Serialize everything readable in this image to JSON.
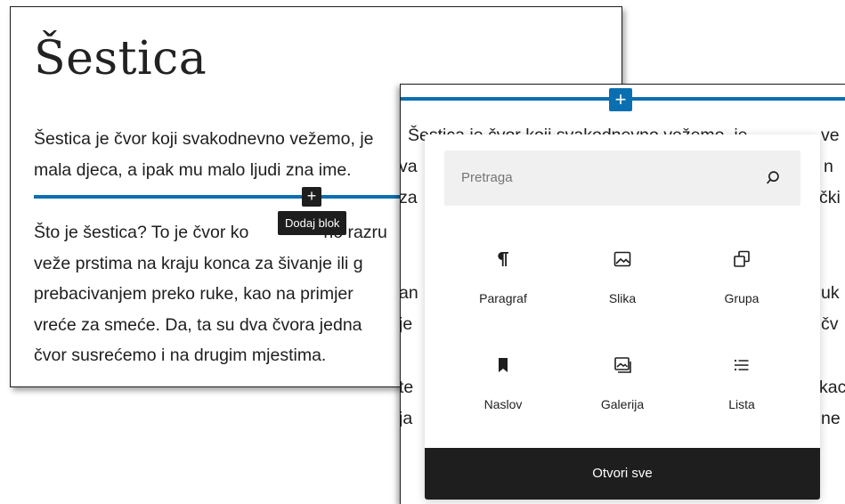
{
  "post": {
    "title": "Šestica",
    "para1_lines": [
      "Šestica je čvor koji svakodnevno vežemo, je",
      "mala djeca, a ipak mu malo ljudi zna ime."
    ],
    "para2_lines": [
      "Što je šestica? To je čvor ko",
      "veže prstima na kraju konca za šivanje ili g",
      "prebacivanjem preko ruke, kao na primjer",
      "vreće za smeće. Da, ta su dva čvora jedna",
      "čvor susrećemo i na drugim mjestima."
    ],
    "para2_line1_after": "no razru"
  },
  "add_block": {
    "small_button_icon": "+",
    "tooltip": "Dodaj blok",
    "large_button_icon": "+"
  },
  "background_fragments": {
    "left": [
      "va",
      "za",
      "an",
      "je",
      "te",
      "ja"
    ],
    "right": [
      "ve",
      "n",
      "čki",
      "uk",
      "čv",
      "kac",
      "ne"
    ]
  },
  "inserter": {
    "search_placeholder": "Pretraga",
    "blocks": [
      {
        "label": "Paragraf",
        "icon": "paragraph-icon"
      },
      {
        "label": "Slika",
        "icon": "image-icon"
      },
      {
        "label": "Grupa",
        "icon": "group-icon"
      },
      {
        "label": "Naslov",
        "icon": "heading-bookmark-icon"
      },
      {
        "label": "Galerija",
        "icon": "gallery-icon"
      },
      {
        "label": "Lista",
        "icon": "list-icon"
      }
    ],
    "browse_all": "Otvori sve"
  },
  "colors": {
    "accent_blue": "#0a6fb0",
    "dark": "#1e1e1e"
  }
}
